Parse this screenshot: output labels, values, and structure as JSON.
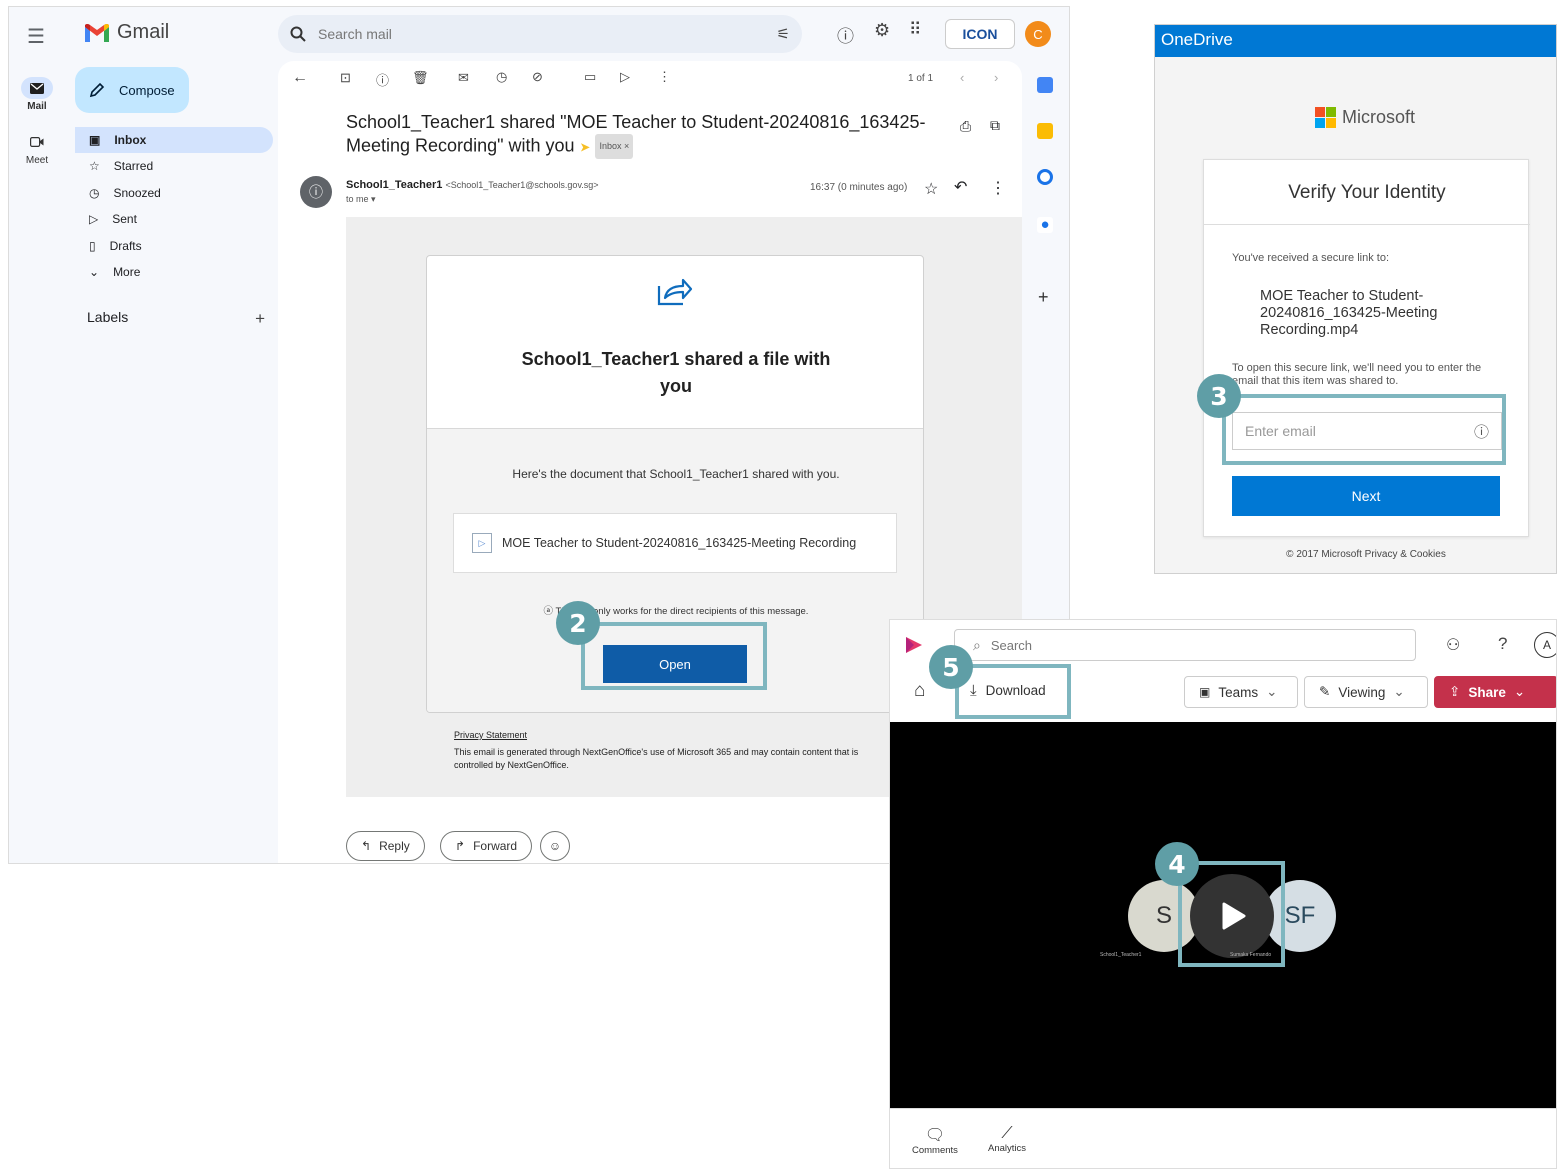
{
  "gmail": {
    "app_name": "Gmail",
    "search_placeholder": "Search mail",
    "brand_badge": "ICON",
    "account_initial": "C",
    "rail": [
      {
        "label": "Mail"
      },
      {
        "label": "Meet"
      }
    ],
    "compose_label": "Compose",
    "nav": [
      {
        "label": "Inbox",
        "active": true
      },
      {
        "label": "Starred"
      },
      {
        "label": "Snoozed"
      },
      {
        "label": "Sent"
      },
      {
        "label": "Drafts"
      },
      {
        "label": "More"
      }
    ],
    "labels_heading": "Labels",
    "pager": "1 of 1",
    "subject": "School1_Teacher1 shared \"MOE Teacher to Student-20240816_163425-Meeting Recording\" with you",
    "inbox_badge": "Inbox ×",
    "sender_name": "School1_Teacher1",
    "sender_email": "<School1_Teacher1@schools.gov.sg>",
    "to_me": "to me",
    "time": "16:37 (0 minutes ago)",
    "card_title": "School1_Teacher1 shared a file with you",
    "card_desc": "Here's the document that School1_Teacher1 shared with you.",
    "file_name": "MOE Teacher to Student-20240816_163425-Meeting Recording",
    "note_text": "This link only works for the direct recipients of this message.",
    "open_label": "Open",
    "privacy_link": "Privacy Statement",
    "footnote": "This email is generated through NextGenOffice's use of Microsoft 365 and may contain content that is controlled by NextGenOffice.",
    "reply_label": "Reply",
    "forward_label": "Forward"
  },
  "onedrive": {
    "bar_title": "OneDrive",
    "brand": "Microsoft",
    "card_title": "Verify Your Identity",
    "received_text": "You've received a secure link to:",
    "file_name": "MOE Teacher to Student-20240816_163425-Meeting Recording.mp4",
    "instructions": "To open this secure link, we'll need you to enter the email that this item was shared to.",
    "email_placeholder": "Enter email",
    "next_label": "Next",
    "footer": "© 2017 Microsoft   Privacy & Cookies"
  },
  "stream": {
    "search_placeholder": "Search",
    "account_initial": "A",
    "download_label": "Download",
    "teams_label": "Teams",
    "viewing_label": "Viewing",
    "share_label": "Share",
    "participant_left": "S",
    "participant_right": "SF",
    "left_caption": "School1_Teacher1",
    "right_caption": "Sumaka Fernando",
    "comments_label": "Comments",
    "analytics_label": "Analytics"
  },
  "annotations": [
    "2",
    "3",
    "4",
    "5"
  ],
  "colors": {
    "annotation": "#7fb6bf",
    "annotation_badge": "#5f9ea6",
    "share": "#c4314b",
    "ms_blue": "#0078d4",
    "open_button": "#0f5ca7"
  }
}
